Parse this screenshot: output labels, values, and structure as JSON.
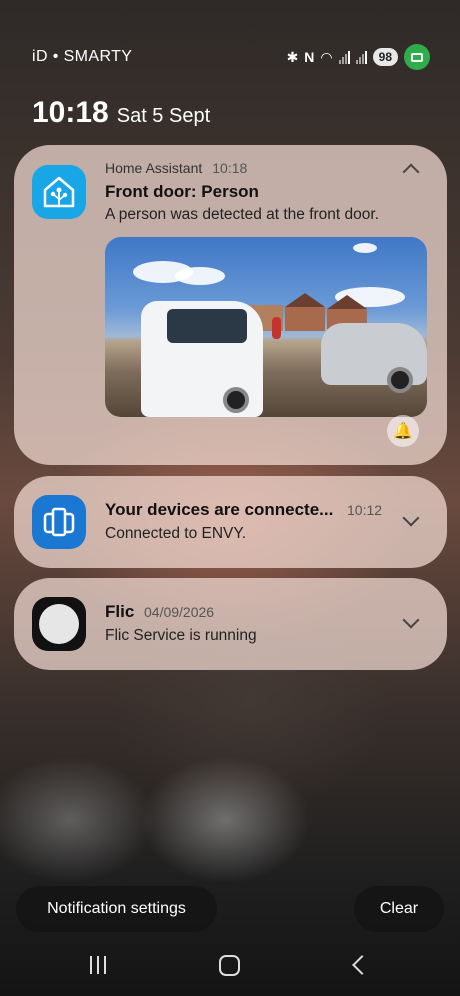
{
  "status_bar": {
    "carrier": "iD • SMARTY",
    "battery": "98",
    "icons": [
      "bluetooth-icon",
      "nfc-icon",
      "wifi-icon",
      "signal-icon",
      "signal-icon",
      "screen-recorder-icon"
    ]
  },
  "lockscreen": {
    "time": "10:18",
    "date": "Sat 5 Sept"
  },
  "notifications": [
    {
      "app": "Home Assistant",
      "time": "10:18",
      "title": "Front door: Person",
      "body": "A person was detected at the front door.",
      "icon": "home-assistant-icon",
      "accent": "#19a6e6",
      "has_image": true,
      "expanded": true
    },
    {
      "app": "",
      "time": "10:12",
      "title": "Your devices are connecte...",
      "body": "Connected to ENVY.",
      "icon": "phone-link-icon",
      "accent": "#1a78d2"
    },
    {
      "app": "Flic",
      "time": "04/09/2026",
      "title": "Flic",
      "body": "Flic Service is running",
      "icon": "flic-icon",
      "accent": "#111111"
    }
  ],
  "actions": {
    "settings_label": "Notification settings",
    "clear_label": "Clear"
  }
}
